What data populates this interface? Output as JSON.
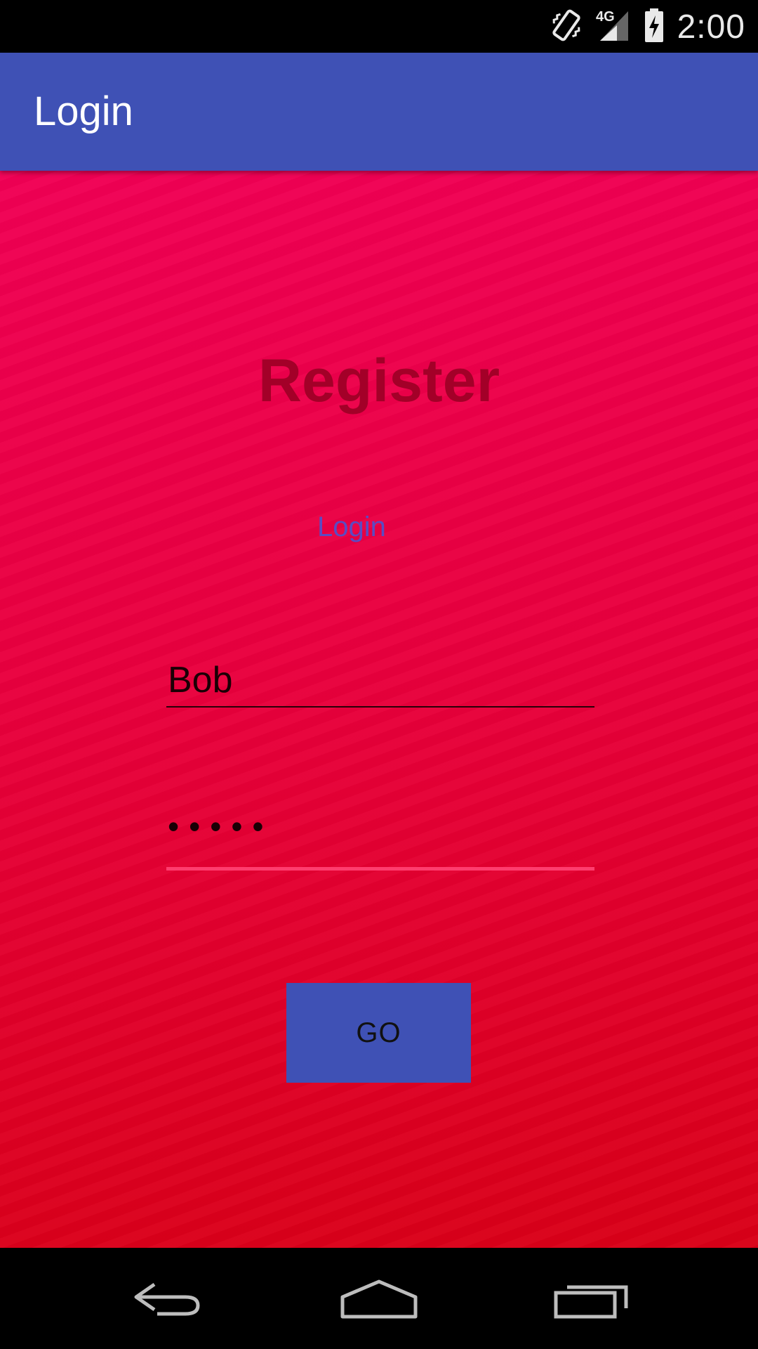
{
  "status_bar": {
    "time": "2:00",
    "network": "4G",
    "icons": [
      "vibrate-icon",
      "signal-4g-icon",
      "battery-charging-icon"
    ]
  },
  "app_bar": {
    "title": "Login"
  },
  "form": {
    "heading": "Register",
    "login_link": "Login",
    "username_value": "Bob",
    "password_value": "•••••",
    "go_button_label": "GO"
  },
  "nav_bar": {
    "icons": [
      "back-icon",
      "home-icon",
      "recents-icon"
    ]
  },
  "colors": {
    "primary": "#3f51b5",
    "accent": "#ff3d6e",
    "background_top": "#f10055",
    "background_bottom": "#d90017",
    "heading": "#a30028",
    "link": "#5b4bc2"
  }
}
